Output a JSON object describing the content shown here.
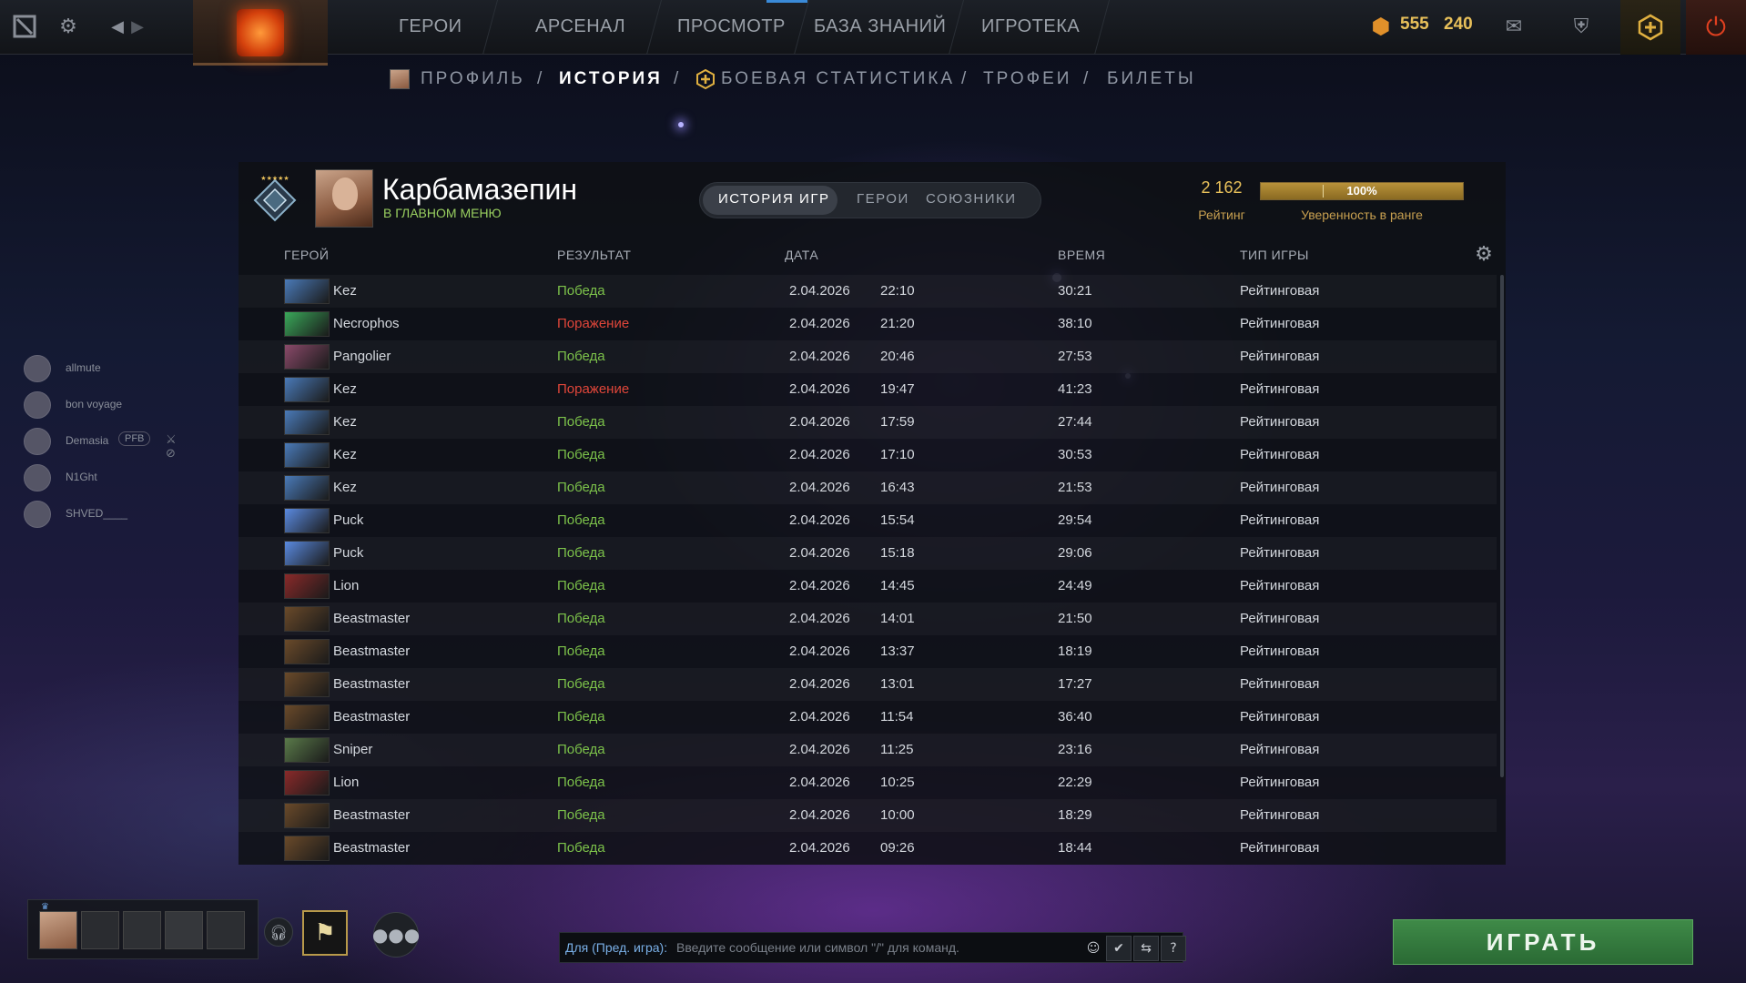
{
  "topbar": {
    "nav": [
      "ГЕРОИ",
      "АРСЕНАЛ",
      "ПРОСМОТР",
      "БАЗА ЗНАНИЙ",
      "ИГРОТЕКА"
    ],
    "shards": "555",
    "tokens": "240"
  },
  "subnav": {
    "items": [
      "ПРОФИЛЬ",
      "ИСТОРИЯ",
      "БОЕВАЯ СТАТИСТИКА",
      "ТРОФЕИ",
      "БИЛЕТЫ"
    ],
    "sep": "/"
  },
  "profile": {
    "name": "Карбамазепин",
    "status": "В ГЛАВНОМ МЕНЮ",
    "tabs": [
      "ИСТОРИЯ ИГР",
      "ГЕРОИ",
      "СОЮЗНИКИ"
    ],
    "rating": "2 162",
    "rating_label": "Рейтинг",
    "confidence": "100%",
    "confidence_value": 1.0,
    "confidence_label": "Уверенность в ранге"
  },
  "table": {
    "headers": {
      "hero": "ГЕРОЙ",
      "result": "РЕЗУЛЬТАТ",
      "date": "ДАТА",
      "time": "ВРЕМЯ",
      "type": "ТИП ИГРЫ"
    },
    "rows": [
      {
        "hero": "Kez",
        "result": "Победа",
        "win": true,
        "date": "2.04.2026",
        "start": "22:10",
        "duration": "30:21",
        "type": "Рейтинговая"
      },
      {
        "hero": "Necrophos",
        "result": "Поражение",
        "win": false,
        "date": "2.04.2026",
        "start": "21:20",
        "duration": "38:10",
        "type": "Рейтинговая"
      },
      {
        "hero": "Pangolier",
        "result": "Победа",
        "win": true,
        "date": "2.04.2026",
        "start": "20:46",
        "duration": "27:53",
        "type": "Рейтинговая"
      },
      {
        "hero": "Kez",
        "result": "Поражение",
        "win": false,
        "date": "2.04.2026",
        "start": "19:47",
        "duration": "41:23",
        "type": "Рейтинговая"
      },
      {
        "hero": "Kez",
        "result": "Победа",
        "win": true,
        "date": "2.04.2026",
        "start": "17:59",
        "duration": "27:44",
        "type": "Рейтинговая"
      },
      {
        "hero": "Kez",
        "result": "Победа",
        "win": true,
        "date": "2.04.2026",
        "start": "17:10",
        "duration": "30:53",
        "type": "Рейтинговая"
      },
      {
        "hero": "Kez",
        "result": "Победа",
        "win": true,
        "date": "2.04.2026",
        "start": "16:43",
        "duration": "21:53",
        "type": "Рейтинговая"
      },
      {
        "hero": "Puck",
        "result": "Победа",
        "win": true,
        "date": "2.04.2026",
        "start": "15:54",
        "duration": "29:54",
        "type": "Рейтинговая"
      },
      {
        "hero": "Puck",
        "result": "Победа",
        "win": true,
        "date": "2.04.2026",
        "start": "15:18",
        "duration": "29:06",
        "type": "Рейтинговая"
      },
      {
        "hero": "Lion",
        "result": "Победа",
        "win": true,
        "date": "2.04.2026",
        "start": "14:45",
        "duration": "24:49",
        "type": "Рейтинговая"
      },
      {
        "hero": "Beastmaster",
        "result": "Победа",
        "win": true,
        "date": "2.04.2026",
        "start": "14:01",
        "duration": "21:50",
        "type": "Рейтинговая"
      },
      {
        "hero": "Beastmaster",
        "result": "Победа",
        "win": true,
        "date": "2.04.2026",
        "start": "13:37",
        "duration": "18:19",
        "type": "Рейтинговая"
      },
      {
        "hero": "Beastmaster",
        "result": "Победа",
        "win": true,
        "date": "2.04.2026",
        "start": "13:01",
        "duration": "17:27",
        "type": "Рейтинговая"
      },
      {
        "hero": "Beastmaster",
        "result": "Победа",
        "win": true,
        "date": "2.04.2026",
        "start": "11:54",
        "duration": "36:40",
        "type": "Рейтинговая"
      },
      {
        "hero": "Sniper",
        "result": "Победа",
        "win": true,
        "date": "2.04.2026",
        "start": "11:25",
        "duration": "23:16",
        "type": "Рейтинговая"
      },
      {
        "hero": "Lion",
        "result": "Победа",
        "win": true,
        "date": "2.04.2026",
        "start": "10:25",
        "duration": "22:29",
        "type": "Рейтинговая"
      },
      {
        "hero": "Beastmaster",
        "result": "Победа",
        "win": true,
        "date": "2.04.2026",
        "start": "10:00",
        "duration": "18:29",
        "type": "Рейтинговая"
      },
      {
        "hero": "Beastmaster",
        "result": "Победа",
        "win": true,
        "date": "2.04.2026",
        "start": "09:26",
        "duration": "18:44",
        "type": "Рейтинговая"
      }
    ]
  },
  "friends": [
    {
      "name": "allmute"
    },
    {
      "name": "bon voyage"
    },
    {
      "name": "Demasia",
      "tag": "PFB"
    },
    {
      "name": "N1Ght"
    },
    {
      "name": "SHVED____"
    }
  ],
  "chat": {
    "channel": "Для (Пред. игра):",
    "placeholder": "Введите сообщение или символ \"/\" для команд."
  },
  "play_label": "ИГРАТЬ",
  "colors": {
    "win": "#7cc24a",
    "loss": "#e0463a",
    "accent_gold": "#e8c05a",
    "play_green": "#3f8a48"
  },
  "hero_colors": {
    "Kez": "#4a7ab8",
    "Necrophos": "#3aa85a",
    "Pangolier": "#8a4a6a",
    "Puck": "#5a8ae0",
    "Lion": "#8a2a2a",
    "Beastmaster": "#6a4a2a",
    "Sniper": "#5a7a4a"
  }
}
